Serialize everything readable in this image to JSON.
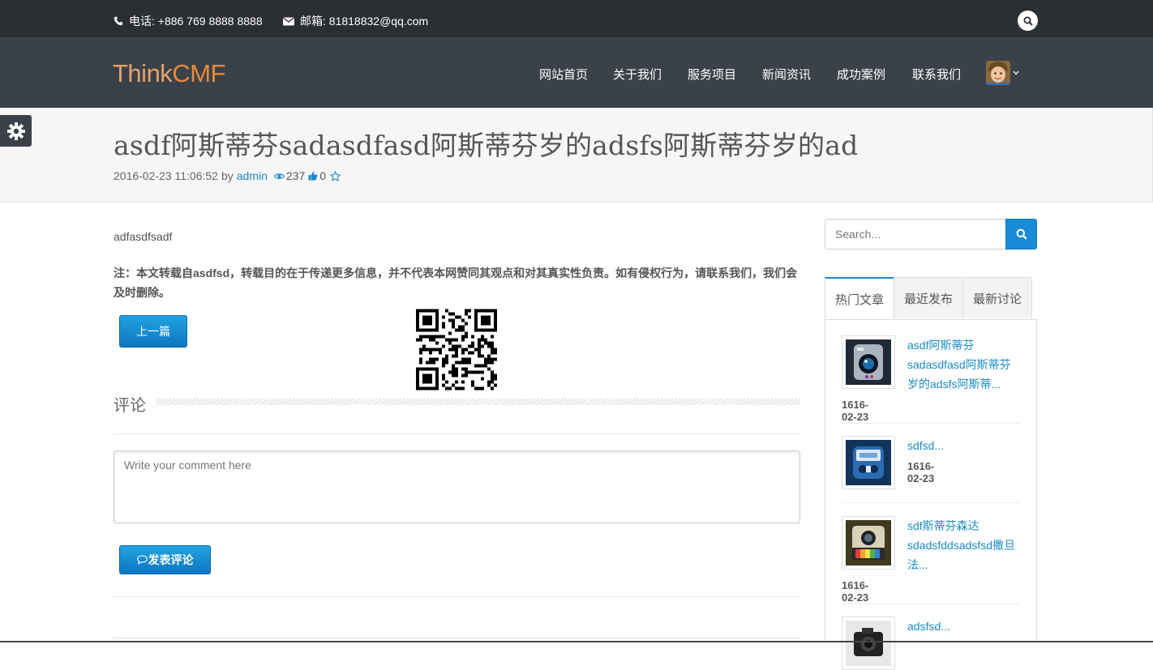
{
  "topbar": {
    "phone": "电话: +886 769 8888 8888",
    "email": "邮箱: 81818832@qq.com"
  },
  "brand": {
    "logo_think": "Think",
    "logo_cmf": "CMF"
  },
  "nav": {
    "items": [
      {
        "label": "网站首页"
      },
      {
        "label": "关于我们"
      },
      {
        "label": "服务项目"
      },
      {
        "label": "新闻资讯"
      },
      {
        "label": "成功案例"
      },
      {
        "label": "联系我们"
      }
    ]
  },
  "article": {
    "title": "asdf阿斯蒂芬sadasdfasd阿斯蒂芬岁的adsfs阿斯蒂芬岁的ad",
    "datetime": "2016-02-23 11:06:52",
    "by": "by",
    "author": "admin",
    "views": "237",
    "likes": "0",
    "excerpt": "adfasdfsadf",
    "notice": "注：本文转载自asdfsd，转载目的在于传递更多信息，并不代表本网赞同其观点和对其真实性负责。如有侵权行为，请联系我们，我们会及时删除。",
    "prev_label": "上一篇"
  },
  "comments": {
    "heading": "评论",
    "placeholder": "Write your comment here",
    "submit_label": "发表评论"
  },
  "sidebar": {
    "search_placeholder": "Search...",
    "tabs": [
      {
        "label": "热门文章"
      },
      {
        "label": "最近发布"
      },
      {
        "label": "最新讨论"
      }
    ],
    "posts": [
      {
        "title": "asdf阿斯蒂芬sadasdfasd阿斯蒂芬岁的adsfs阿斯蒂...",
        "date": "1616-02-23"
      },
      {
        "title": "sdfsd...",
        "date": "1616-02-23"
      },
      {
        "title": "sdf斯蒂芬森达sdadsfddsadsfsd撒旦法...",
        "date": "1616-02-23"
      },
      {
        "title": "adsfsd...",
        "date": ""
      }
    ]
  },
  "colors": {
    "accent": "#1a8bc9",
    "topbar": "#2b2e33",
    "navbar": "#3b4149",
    "logo": "#e88a3c"
  }
}
